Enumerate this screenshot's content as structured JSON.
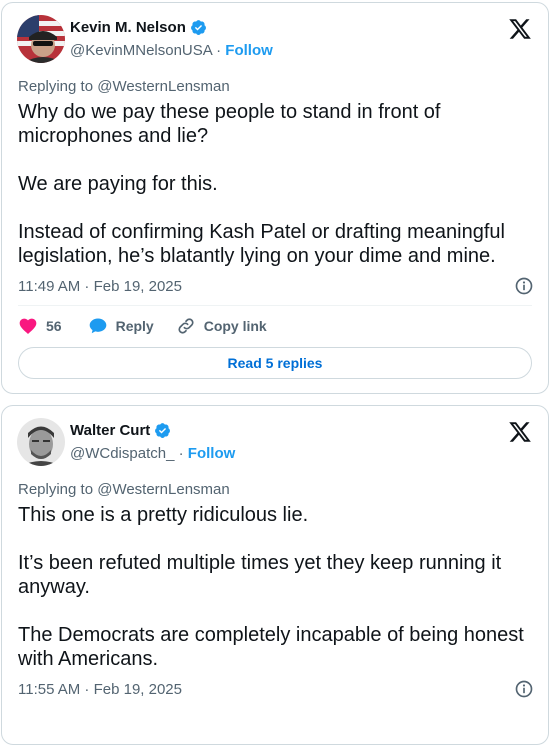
{
  "tweets": [
    {
      "author_name": "Kevin M. Nelson",
      "handle": "@KevinMNelsonUSA",
      "separator": "·",
      "follow_label": "Follow",
      "replying_to": "Replying to @WesternLensman",
      "text": "Why do we pay these people to stand in front of microphones and lie?\n\nWe are paying for this.\n\nInstead of confirming Kash Patel or drafting meaningful legislation, he’s blatantly lying on your dime and mine.",
      "timestamp": "11:49 AM · Feb 19, 2025",
      "likes": "56",
      "reply_label": "Reply",
      "copy_link_label": "Copy link",
      "read_replies_label": "Read 5 replies",
      "verified_color": "#1d9bf0"
    },
    {
      "author_name": "Walter Curt",
      "handle": "@WCdispatch_",
      "separator": "·",
      "follow_label": "Follow",
      "replying_to": "Replying to @WesternLensman",
      "text": "This one is a pretty ridiculous lie.\n\nIt’s been refuted multiple times yet they keep running it anyway.\n\nThe Democrats are completely incapable of being honest with Americans.",
      "timestamp": "11:55 AM · Feb 19, 2025",
      "verified_color": "#1d9bf0"
    }
  ],
  "colors": {
    "like": "#f91880",
    "reply": "#1d9bf0",
    "link": "#006fd6",
    "muted": "#536471"
  },
  "icons": [
    "verified-badge-icon",
    "x-logo-icon",
    "info-icon",
    "heart-icon",
    "reply-bubble-icon",
    "link-icon"
  ]
}
